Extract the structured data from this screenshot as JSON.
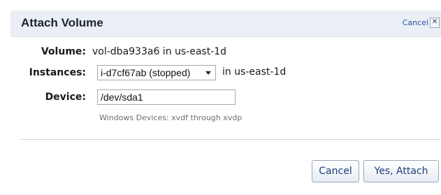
{
  "dialog": {
    "title": "Attach Volume",
    "cancel_link": "Cancel",
    "close_glyph": "✕"
  },
  "form": {
    "volume_label": "Volume:",
    "volume_value": "vol-dba933a6 in us-east-1d",
    "instances_label": "Instances:",
    "instances_selected": "i-d7cf67ab (stopped)",
    "instances_suffix": "in us-east-1d",
    "device_label": "Device:",
    "device_value": "/dev/sda1",
    "device_hint": "Windows Devices: xvdf through xvdp"
  },
  "buttons": {
    "cancel": "Cancel",
    "confirm": "Yes, Attach"
  },
  "colors": {
    "header_bg": "#eaeff5",
    "link": "#2a53a0",
    "button_text": "#1d3f7a"
  }
}
